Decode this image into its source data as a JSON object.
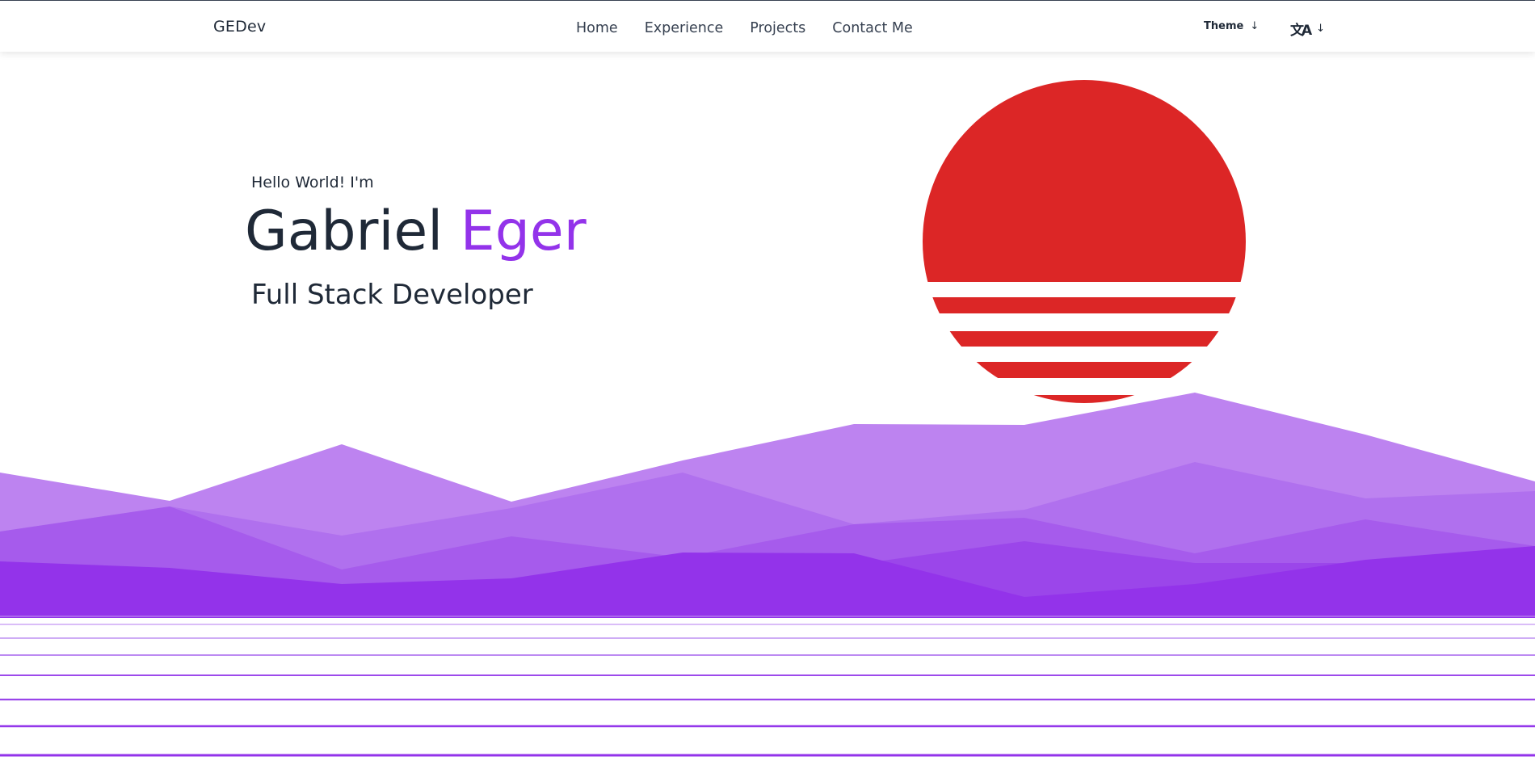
{
  "nav": {
    "brand": "GEDev",
    "links": [
      "Home",
      "Experience",
      "Projects",
      "Contact Me"
    ],
    "theme_label": "Theme",
    "theme_arrow": "↓",
    "lang_icon": "translate-icon",
    "lang_glyph": "文A",
    "lang_arrow": "↓"
  },
  "hero": {
    "greeting": "Hello World! I'm",
    "first_name": "Gabriel",
    "last_name": "Eger",
    "role": "Full Stack Developer"
  },
  "colors": {
    "accent": "#9333ea",
    "sun": "#dc2626",
    "text": "#1f2937"
  }
}
